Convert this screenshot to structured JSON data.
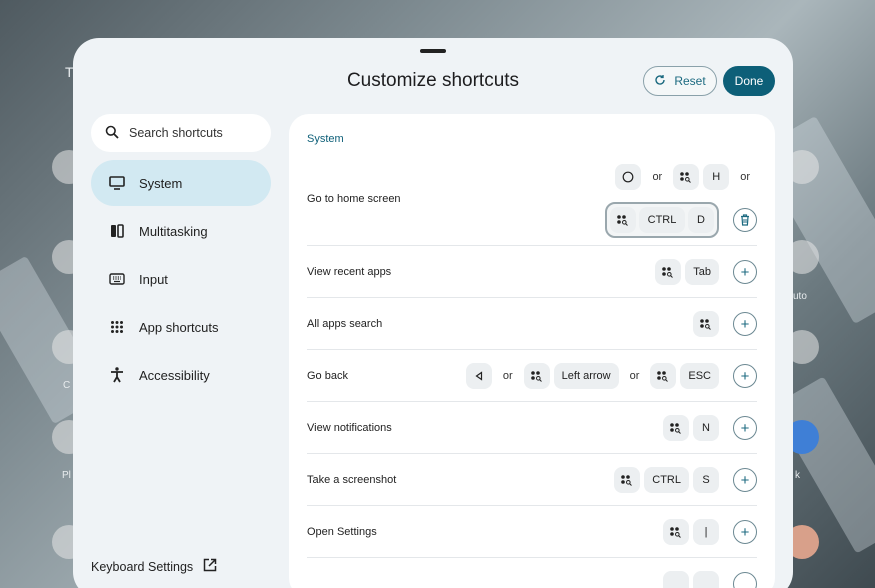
{
  "background": {
    "partial_texts": [
      "T",
      "C",
      "Pl",
      "uto",
      "k"
    ]
  },
  "dialog": {
    "title": "Customize shortcuts",
    "reset_label": "Reset",
    "done_label": "Done"
  },
  "search": {
    "placeholder": "Search shortcuts"
  },
  "sidebar": {
    "items": [
      {
        "label": "System",
        "icon": "monitor-icon",
        "active": true
      },
      {
        "label": "Multitasking",
        "icon": "split-screen-icon",
        "active": false
      },
      {
        "label": "Input",
        "icon": "keyboard-icon",
        "active": false
      },
      {
        "label": "App shortcuts",
        "icon": "grid-icon",
        "active": false
      },
      {
        "label": "Accessibility",
        "icon": "accessibility-icon",
        "active": false
      }
    ],
    "keyboard_settings_label": "Keyboard Settings"
  },
  "section_title": "System",
  "or_text": "or",
  "shortcuts": [
    {
      "label": "Go to home screen",
      "keys_line1": [
        "home-circle-icon",
        "or",
        "launcher-icon",
        "H",
        "or"
      ],
      "keys_line2": [
        "launcher-icon",
        "CTRL",
        "D"
      ]
    },
    {
      "label": "View recent apps",
      "keys": [
        "launcher-icon",
        "Tab"
      ]
    },
    {
      "label": "All apps search",
      "keys": [
        "launcher-icon"
      ]
    },
    {
      "label": "Go back",
      "keys": [
        "back-icon",
        "or",
        "launcher-icon",
        "Left arrow",
        "or",
        "launcher-icon",
        "ESC"
      ]
    },
    {
      "label": "View notifications",
      "keys": [
        "launcher-icon",
        "N"
      ]
    },
    {
      "label": "Take a screenshot",
      "keys": [
        "launcher-icon",
        "CTRL",
        "S"
      ]
    },
    {
      "label": "Open Settings",
      "keys": [
        "launcher-icon",
        "I"
      ]
    }
  ],
  "key_text": {
    "h": "H",
    "ctrl": "CTRL",
    "d": "D",
    "tab": "Tab",
    "left_arrow": "Left arrow",
    "esc": "ESC",
    "n": "N",
    "s": "S",
    "i": "|"
  }
}
